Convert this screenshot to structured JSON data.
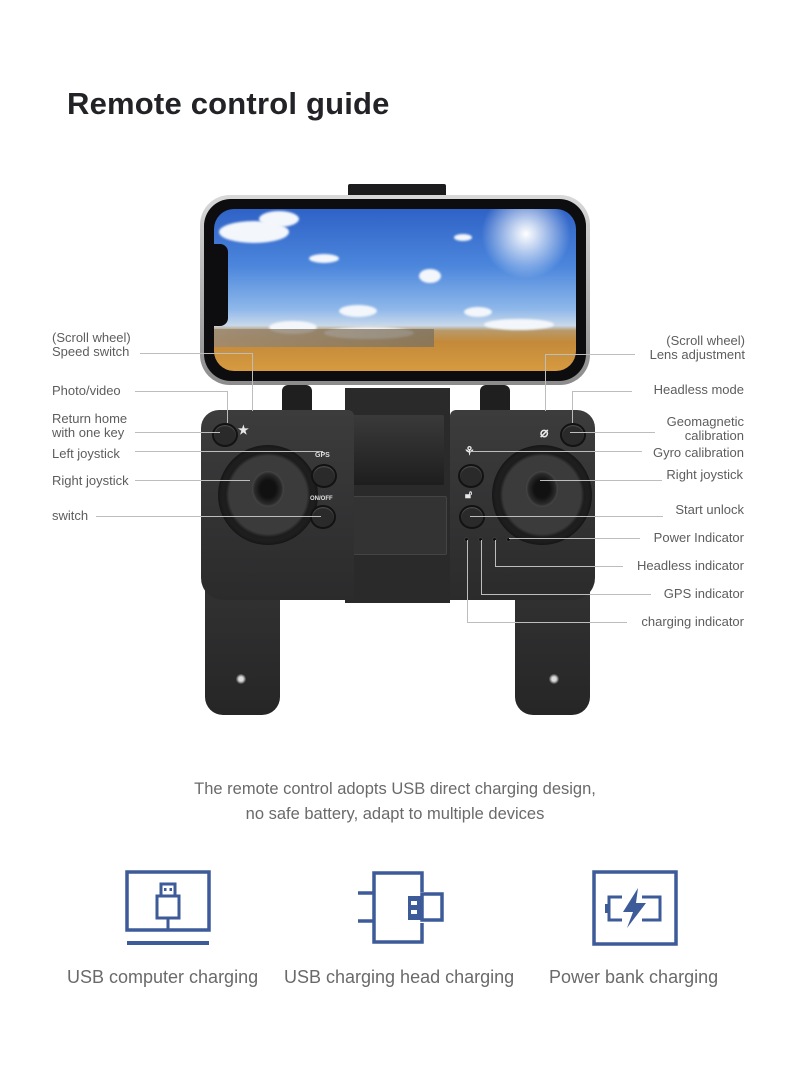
{
  "page": {
    "title": "Remote control guide",
    "accent_color": "#3d5a99"
  },
  "left_labels": [
    {
      "text": "(Scroll wheel)",
      "text2": "Speed switch"
    },
    {
      "text": "Photo/video"
    },
    {
      "text": "Return home",
      "text2": "with one key"
    },
    {
      "text": "Left joystick"
    },
    {
      "text": "Right joystick"
    },
    {
      "text": "switch"
    }
  ],
  "right_labels": [
    {
      "text": "(Scroll wheel)",
      "text2": "Lens adjustment"
    },
    {
      "text": "Headless mode"
    },
    {
      "text": "Geomagnetic",
      "text2": "calibration"
    },
    {
      "text": "Gyro calibration"
    },
    {
      "text": "Right joystick"
    },
    {
      "text": "Start unlock"
    },
    {
      "text": "Power Indicator"
    },
    {
      "text": "Headless indicator"
    },
    {
      "text": "GPS indicator"
    },
    {
      "text": "charging indicator"
    }
  ],
  "controller": {
    "gps_label": "GPS",
    "onoff_label": "ON/OFF",
    "return_icon": "return-home-icon",
    "headless_icon": "headless-compass-icon",
    "gyro_icon": "gyro-calibration-icon",
    "unlock_icon": "unlock-padlock-icon"
  },
  "description": {
    "line1": "The remote control adopts USB direct charging design,",
    "line2": "no safe battery, adapt to multiple devices"
  },
  "charging_options": [
    {
      "icon": "usb-computer-icon",
      "label": "USB computer charging"
    },
    {
      "icon": "usb-charging-head-icon",
      "label": "USB charging head charging"
    },
    {
      "icon": "power-bank-icon",
      "label": "Power bank charging"
    }
  ]
}
